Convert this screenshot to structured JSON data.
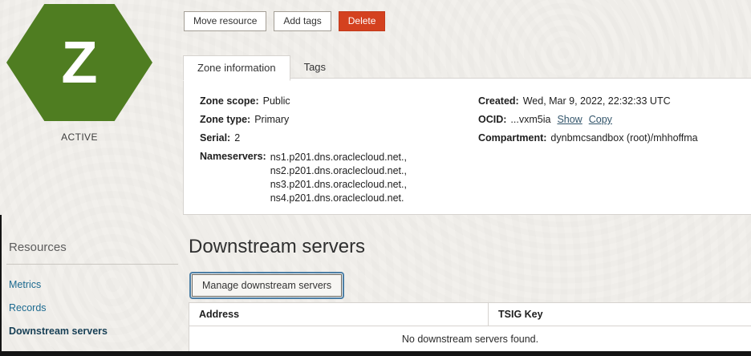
{
  "colors": {
    "hexagon_green": "#4f7d21",
    "delete_red": "#d4411f",
    "link_blue": "#1c6a90",
    "active_link": "#173f55"
  },
  "status": {
    "letter": "Z",
    "label": "ACTIVE"
  },
  "toolbar": {
    "move_resource": "Move resource",
    "add_tags": "Add tags",
    "delete": "Delete"
  },
  "tabs": {
    "zone_information": "Zone information",
    "tags": "Tags"
  },
  "zone_info": {
    "left": {
      "zone_scope": {
        "label": "Zone scope:",
        "value": "Public"
      },
      "zone_type": {
        "label": "Zone type:",
        "value": "Primary"
      },
      "serial": {
        "label": "Serial:",
        "value": "2"
      },
      "nameservers": {
        "label": "Nameservers:",
        "lines": [
          "ns1.p201.dns.oraclecloud.net.,",
          "ns2.p201.dns.oraclecloud.net.,",
          "ns3.p201.dns.oraclecloud.net.,",
          "ns4.p201.dns.oraclecloud.net."
        ]
      }
    },
    "right": {
      "created": {
        "label": "Created:",
        "value": "Wed, Mar 9, 2022, 22:32:33 UTC"
      },
      "ocid": {
        "label": "OCID:",
        "value": "...vxm5ia",
        "show": "Show",
        "copy": "Copy"
      },
      "compartment": {
        "label": "Compartment:",
        "value": "dynbmcsandbox (root)/mhhoffma"
      }
    }
  },
  "sidebar": {
    "heading": "Resources",
    "items": [
      {
        "label": "Metrics",
        "active": false
      },
      {
        "label": "Records",
        "active": false
      },
      {
        "label": "Downstream servers",
        "active": true
      }
    ]
  },
  "downstream": {
    "heading": "Downstream servers",
    "manage_button": "Manage downstream servers",
    "table": {
      "columns": [
        "Address",
        "TSIG Key"
      ],
      "empty_message": "No downstream servers found."
    }
  }
}
